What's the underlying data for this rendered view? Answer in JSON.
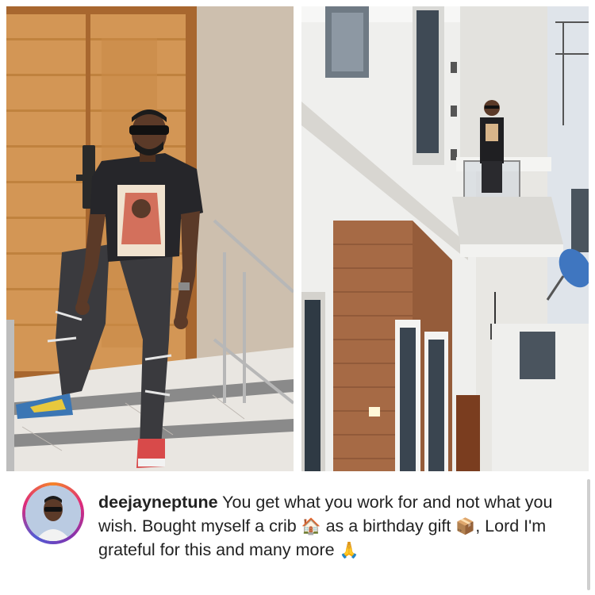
{
  "post": {
    "username": "deejayneptune",
    "caption_parts": [
      " You get what you work for and not what you wish. Bought myself a crib ",
      " as a birthday gift ",
      ", Lord I'm grateful for this and many more "
    ],
    "emojis": {
      "house": "🏠",
      "gift": "📦",
      "pray": "🙏"
    }
  },
  "images": {
    "left_photo_icon": "man-on-stairs-photo",
    "right_photo_icon": "house-exterior-photo"
  },
  "colors": {
    "story_ring_start": "#f58529",
    "story_ring_mid": "#dd2a7b",
    "story_ring_end": "#515bd4",
    "text": "#222222"
  }
}
